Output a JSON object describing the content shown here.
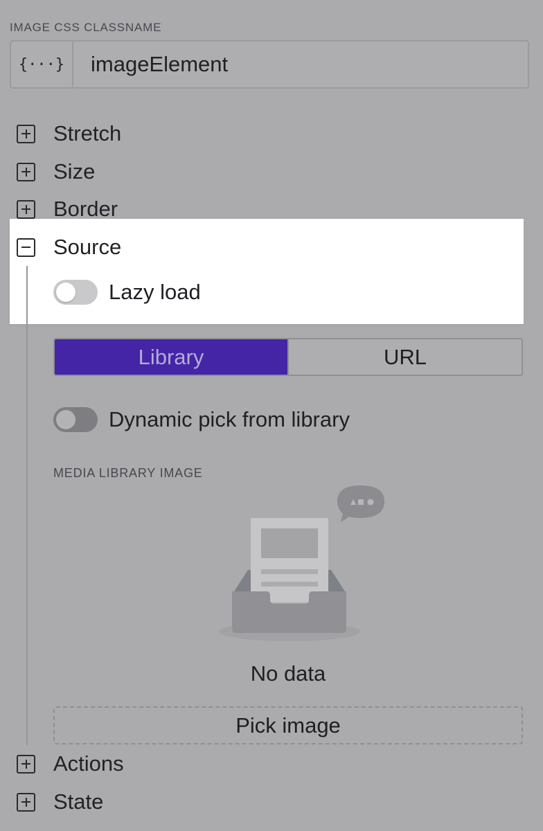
{
  "css_classname": {
    "caption": "IMAGE CSS CLASSNAME",
    "prefix_icon": "curly-braces-icon",
    "prefix_text": "{···}",
    "value": "imageElement"
  },
  "sections": {
    "stretch": {
      "label": "Stretch",
      "expanded": false
    },
    "size": {
      "label": "Size",
      "expanded": false
    },
    "border": {
      "label": "Border",
      "expanded": false
    },
    "source": {
      "label": "Source",
      "expanded": true
    },
    "actions": {
      "label": "Actions",
      "expanded": false
    },
    "state": {
      "label": "State",
      "expanded": false
    }
  },
  "source": {
    "lazy_load": {
      "label": "Lazy load",
      "enabled": false
    },
    "tabs": [
      {
        "label": "Library",
        "active": true
      },
      {
        "label": "URL",
        "active": false
      }
    ],
    "dynamic_pick": {
      "label": "Dynamic pick from library",
      "enabled": false
    },
    "media_caption": "MEDIA LIBRARY IMAGE",
    "empty_icon": "empty-inbox-icon",
    "empty_text": "No data",
    "pick_button": "Pick image"
  },
  "colors": {
    "background": "#ababad",
    "highlight": "#ffffff",
    "active_tab": "#4425a6",
    "active_tab_text": "#b5abd7"
  }
}
